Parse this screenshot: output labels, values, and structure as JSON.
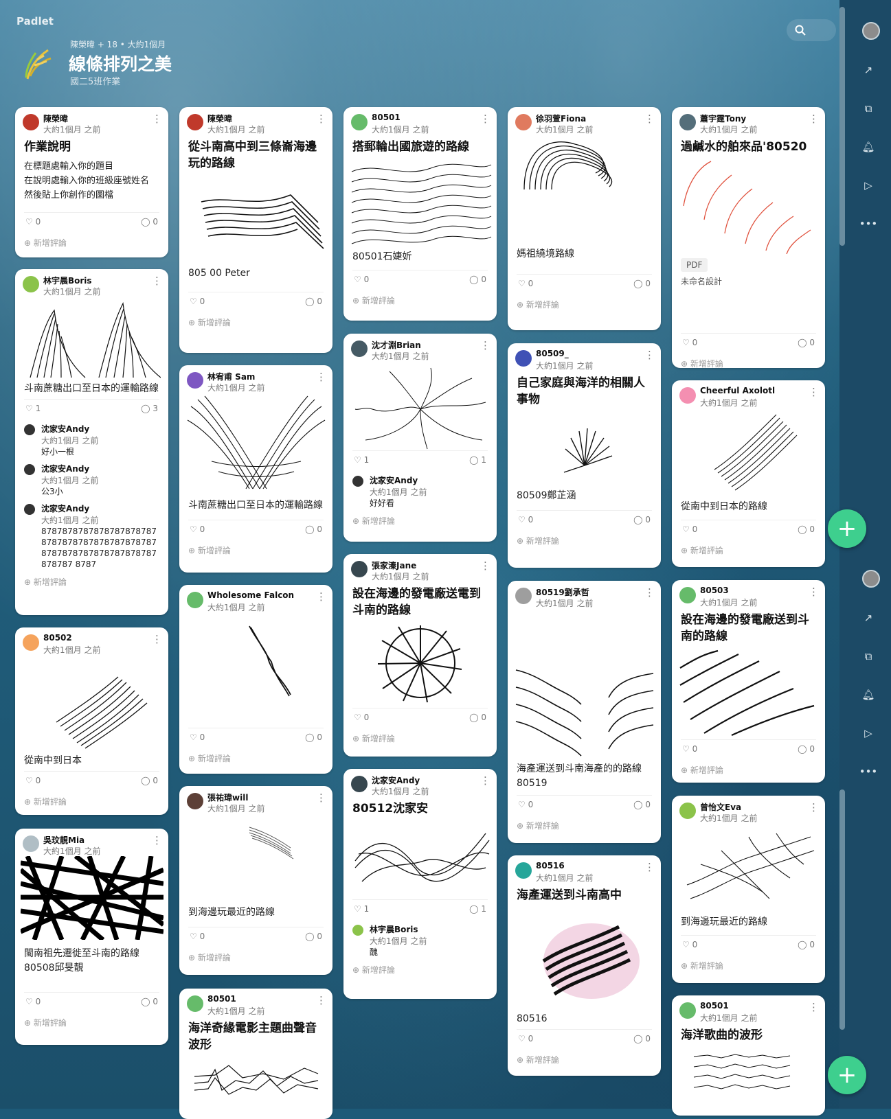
{
  "app": {
    "brand": "Padlet"
  },
  "header": {
    "meta": "陳榮暐 + 18 • 大約1個月",
    "title": "線條排列之美",
    "subtitle": "國二5班作業"
  },
  "common": {
    "time": "大約1個月 之前",
    "add_comment": "新增評論",
    "more": "⋮"
  },
  "colors": {
    "accent": "#3ecf8e",
    "rail": "#1c4a66"
  },
  "cards": {
    "c1": {
      "author": "陳榮暐",
      "title": "作業說明",
      "body": [
        "在標題處輸入你的題目",
        "在說明處輸入你的班級座號姓名",
        "然後貼上你創作的圖檔"
      ],
      "likes": "0",
      "comments": "0"
    },
    "c2": {
      "author": "林宇晨Boris",
      "caption": "斗南蔗糖出口至日本的運輸路線",
      "likes": "1",
      "comments": "3",
      "comment_list": [
        {
          "name": "沈家安Andy",
          "text": "好小一根"
        },
        {
          "name": "沈家安Andy",
          "text": "公3小"
        },
        {
          "name": "沈家安Andy",
          "text": "878787878787878787878787878787878787878787878787878787878787878787878787 8787"
        }
      ]
    },
    "c3": {
      "author": "80502",
      "caption": "從南中到日本",
      "likes": "0",
      "comments": "0"
    },
    "c4": {
      "author": "吳玟靚Mia",
      "caption": "閩南祖先遷徙至斗南的路線 80508邱旻靚",
      "likes": "0",
      "comments": "0"
    },
    "c5": {
      "author": "陳榮暐",
      "title": "從斗南高中到三條崙海邊玩的路線",
      "caption": "805 00 Peter",
      "likes": "0",
      "comments": "0"
    },
    "c6": {
      "author": "林宥甫 Sam",
      "caption": "斗南蔗糖出口至日本的運輸路線",
      "likes": "0",
      "comments": "0"
    },
    "c7": {
      "author": "Wholesome Falcon",
      "likes": "0",
      "comments": "0"
    },
    "c8": {
      "author": "張祐瑋will",
      "caption": "到海邊玩最近的路線",
      "likes": "0",
      "comments": "0"
    },
    "c9": {
      "author": "80501",
      "title": "海洋奇緣電影主題曲聲音波形"
    },
    "c10": {
      "author": "80501",
      "title": "搭郵輪出國旅遊的路線",
      "caption": "80501石婕妡",
      "likes": "0",
      "comments": "0"
    },
    "c11": {
      "author": "沈才淵Brian",
      "likes": "1",
      "comments": "1",
      "comment_list": [
        {
          "name": "沈家安Andy",
          "text": "好好看"
        }
      ]
    },
    "c12": {
      "author": "張家溱Jane",
      "title": "設在海邊的發電廠送電到斗南的路線",
      "likes": "0",
      "comments": "0"
    },
    "c13": {
      "author": "沈家安Andy",
      "title": "80512沈家安",
      "likes": "1",
      "comments": "1",
      "comment_list": [
        {
          "name": "林宇晨Boris",
          "text": "醜"
        }
      ]
    },
    "c14": {
      "author": "徐羽萱Fiona",
      "caption": "媽祖繞境路線",
      "likes": "0",
      "comments": "0"
    },
    "c15": {
      "author": "80509_",
      "title": "自己家庭與海洋的相關人事物",
      "caption": "80509鄭芷涵",
      "likes": "0",
      "comments": "0"
    },
    "c16": {
      "author": "80519劉承哲",
      "caption": "海產運送到斗南海產的的路線 80519",
      "likes": "0",
      "comments": "0"
    },
    "c17": {
      "author": "80516",
      "title": "海產運送到斗南高中",
      "caption": "80516",
      "likes": "0",
      "comments": "0"
    },
    "c18": {
      "author": "蕭宇霆Tony",
      "title": "過鹹水的舶來品'80520",
      "pdf": "PDF",
      "caption": "未命名設計",
      "likes": "0",
      "comments": "0"
    },
    "c19": {
      "author": "Cheerful Axolotl",
      "caption": "從南中到日本的路線",
      "likes": "0",
      "comments": "0"
    },
    "c20": {
      "author": "80503",
      "title": "設在海邊的發電廠送到斗南的路線",
      "likes": "0",
      "comments": "0"
    },
    "c21": {
      "author": "曾怡文Eva",
      "caption": "到海邊玩最近的路線",
      "likes": "0",
      "comments": "0"
    },
    "c22": {
      "author": "80501",
      "title": "海洋歌曲的波形"
    }
  }
}
